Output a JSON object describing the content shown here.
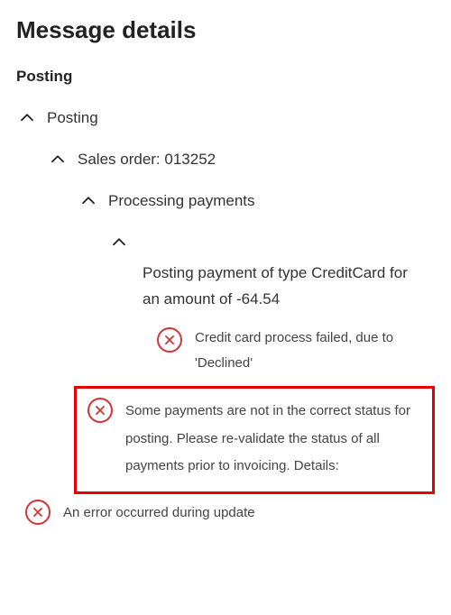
{
  "header": {
    "title": "Message details"
  },
  "subhead": "Posting",
  "tree": {
    "level1": {
      "label": "Posting"
    },
    "level2": {
      "label": "Sales order: 013252"
    },
    "level3": {
      "label": "Processing payments"
    },
    "level4_text": "Posting payment of type CreditCard for an amount of -64.54"
  },
  "errors": {
    "e1": "Credit card process failed, due to 'Declined'",
    "e2": "Some payments are not in the correct status for posting. Please re-validate the status of all payments prior to invoicing. Details:",
    "e3": "An error occurred during update"
  }
}
